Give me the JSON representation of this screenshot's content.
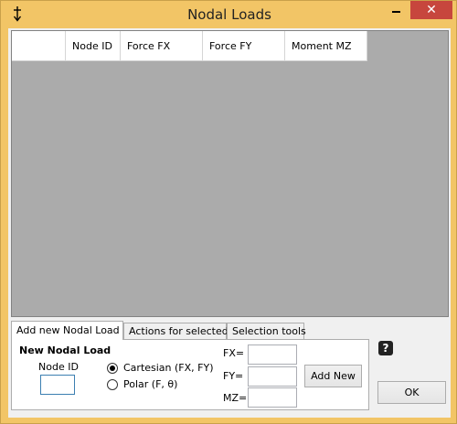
{
  "window": {
    "title": "Nodal Loads",
    "close_glyph": "✕"
  },
  "grid": {
    "columns": [
      "",
      "Node ID",
      "Force FX",
      "Force FY",
      "Moment MZ"
    ],
    "rows": []
  },
  "tabs": [
    {
      "label": "Add new Nodal Load",
      "active": true
    },
    {
      "label": "Actions for selected",
      "active": false
    },
    {
      "label": "Selection tools",
      "active": false
    }
  ],
  "panel": {
    "group_title": "New Nodal Load",
    "node_id_label": "Node ID",
    "node_id_value": "",
    "coord_options": [
      {
        "label": "Cartesian (FX, FY)",
        "checked": true
      },
      {
        "label": "Polar (F, θ)",
        "checked": false
      }
    ],
    "fx_label": "FX=",
    "fy_label": "FY=",
    "mz_label": "MZ=",
    "fx_value": "",
    "fy_value": "",
    "mz_value": "",
    "add_new_label": "Add New"
  },
  "help_glyph": "?",
  "ok_label": "OK",
  "icons": {
    "app": "pin-arrow-icon",
    "help": "help-icon"
  },
  "colors": {
    "frame": "#f2c566",
    "close_button": "#c7463d",
    "grid_background": "#ababab"
  }
}
